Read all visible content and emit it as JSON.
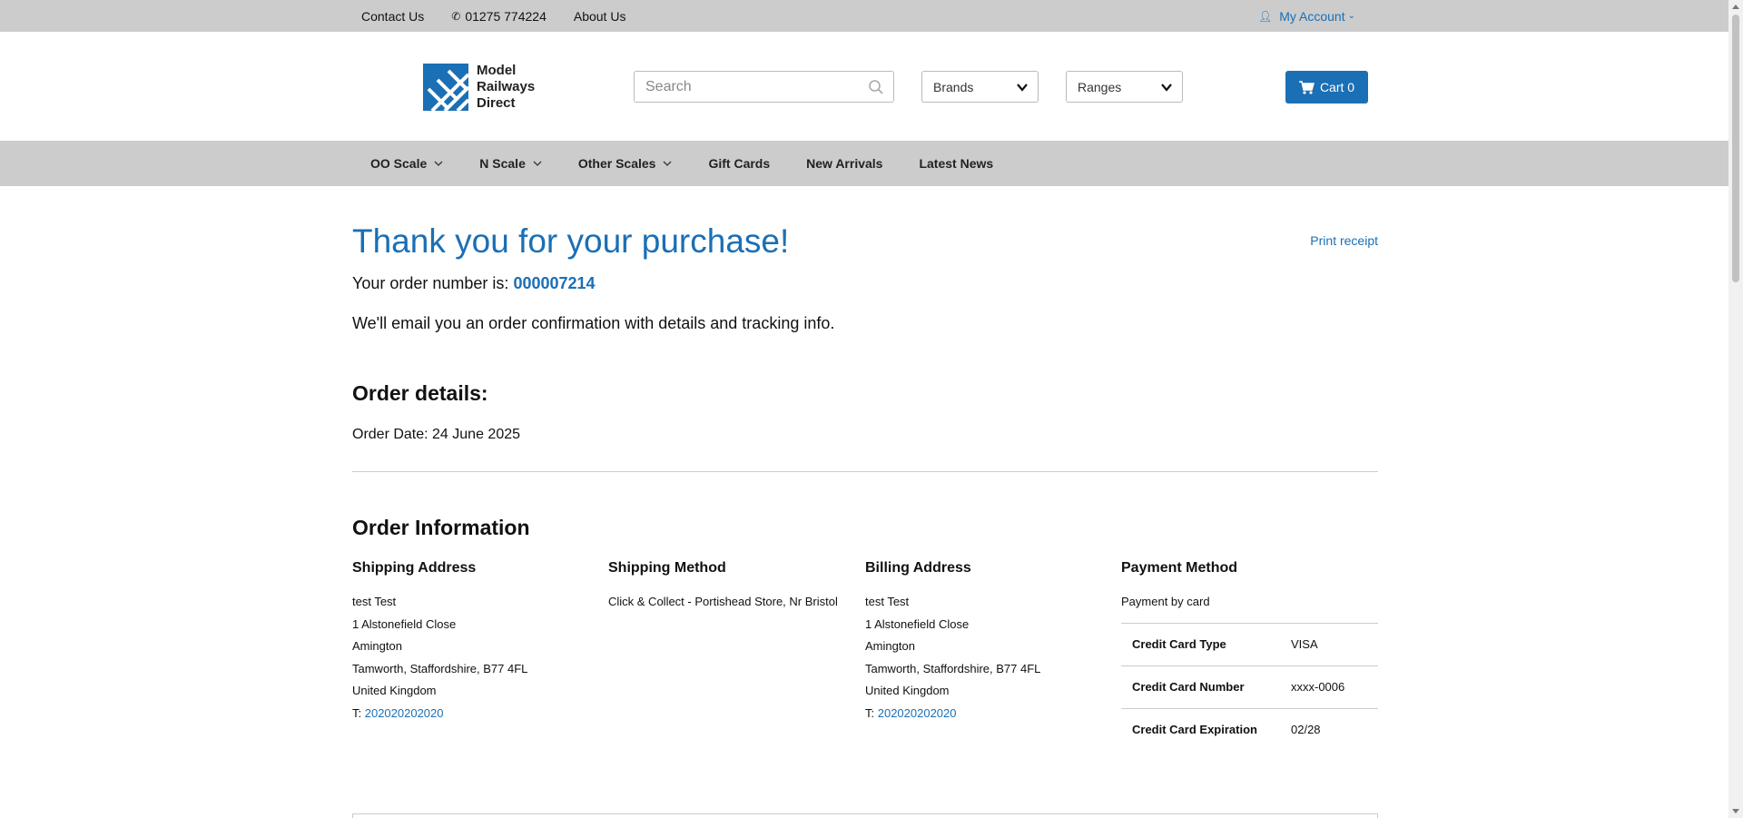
{
  "topbar": {
    "contact": "Contact Us",
    "phone": "01275 774224",
    "about": "About Us",
    "account": "My Account"
  },
  "header": {
    "logo_line1": "Model",
    "logo_line2": "Railways",
    "logo_line3": "Direct",
    "search_placeholder": "Search",
    "brands": "Brands",
    "ranges": "Ranges",
    "cart": "Cart 0"
  },
  "nav": {
    "items": [
      "OO Scale",
      "N Scale",
      "Other Scales",
      "Gift Cards",
      "New Arrivals",
      "Latest News"
    ]
  },
  "main": {
    "title": "Thank you for your purchase!",
    "print": "Print receipt",
    "order_prefix": "Your order number is: ",
    "order_number": "000007214",
    "confirm": "We'll email you an order confirmation with details and tracking info.",
    "details_heading": "Order details:",
    "order_date": "Order Date: 24 June 2025",
    "info_heading": "Order Information"
  },
  "shipping_address": {
    "heading": "Shipping Address",
    "name": "test Test",
    "street": "1 Alstonefield Close",
    "area": "Amington",
    "city": "Tamworth, Staffordshire, B77 4FL",
    "country": "United Kingdom",
    "tel_prefix": "T: ",
    "tel": "202020202020"
  },
  "shipping_method": {
    "heading": "Shipping Method",
    "value": "Click & Collect - Portishead Store, Nr Bristol"
  },
  "billing_address": {
    "heading": "Billing Address",
    "name": "test Test",
    "street": "1 Alstonefield Close",
    "area": "Amington",
    "city": "Tamworth, Staffordshire, B77 4FL",
    "country": "United Kingdom",
    "tel_prefix": "T: ",
    "tel": "202020202020"
  },
  "payment": {
    "heading": "Payment Method",
    "method": "Payment by card",
    "rows": [
      {
        "key": "Credit Card Type",
        "value": "VISA"
      },
      {
        "key": "Credit Card Number",
        "value": "xxxx-0006"
      },
      {
        "key": "Credit Card Expiration",
        "value": "02/28"
      }
    ]
  },
  "colors": {
    "accent": "#1a6fb5",
    "bar": "#cccccc"
  }
}
